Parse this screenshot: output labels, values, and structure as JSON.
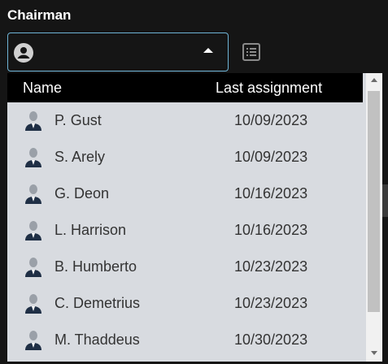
{
  "field": {
    "label": "Chairman",
    "value": ""
  },
  "dropdown": {
    "columns": [
      "Name",
      "Last assignment"
    ],
    "rows": [
      {
        "name": "P. Gust",
        "last_assignment": "10/09/2023"
      },
      {
        "name": "S. Arely",
        "last_assignment": "10/09/2023"
      },
      {
        "name": "G. Deon",
        "last_assignment": "10/16/2023"
      },
      {
        "name": "L. Harrison",
        "last_assignment": "10/16/2023"
      },
      {
        "name": "B. Humberto",
        "last_assignment": "10/23/2023"
      },
      {
        "name": "C. Demetrius",
        "last_assignment": "10/23/2023"
      },
      {
        "name": "M. Thaddeus",
        "last_assignment": "10/30/2023"
      }
    ]
  },
  "icons": {
    "combo_left": "person-circle-icon",
    "combo_right": "caret-up-icon",
    "list": "list-icon",
    "row_avatar": "person-avatar-icon"
  },
  "colors": {
    "background": "#151515",
    "accent_border": "#6fb4d6",
    "dropdown_bg": "#d8dbe0",
    "header_bg": "#000000",
    "text_dark": "#333333"
  }
}
